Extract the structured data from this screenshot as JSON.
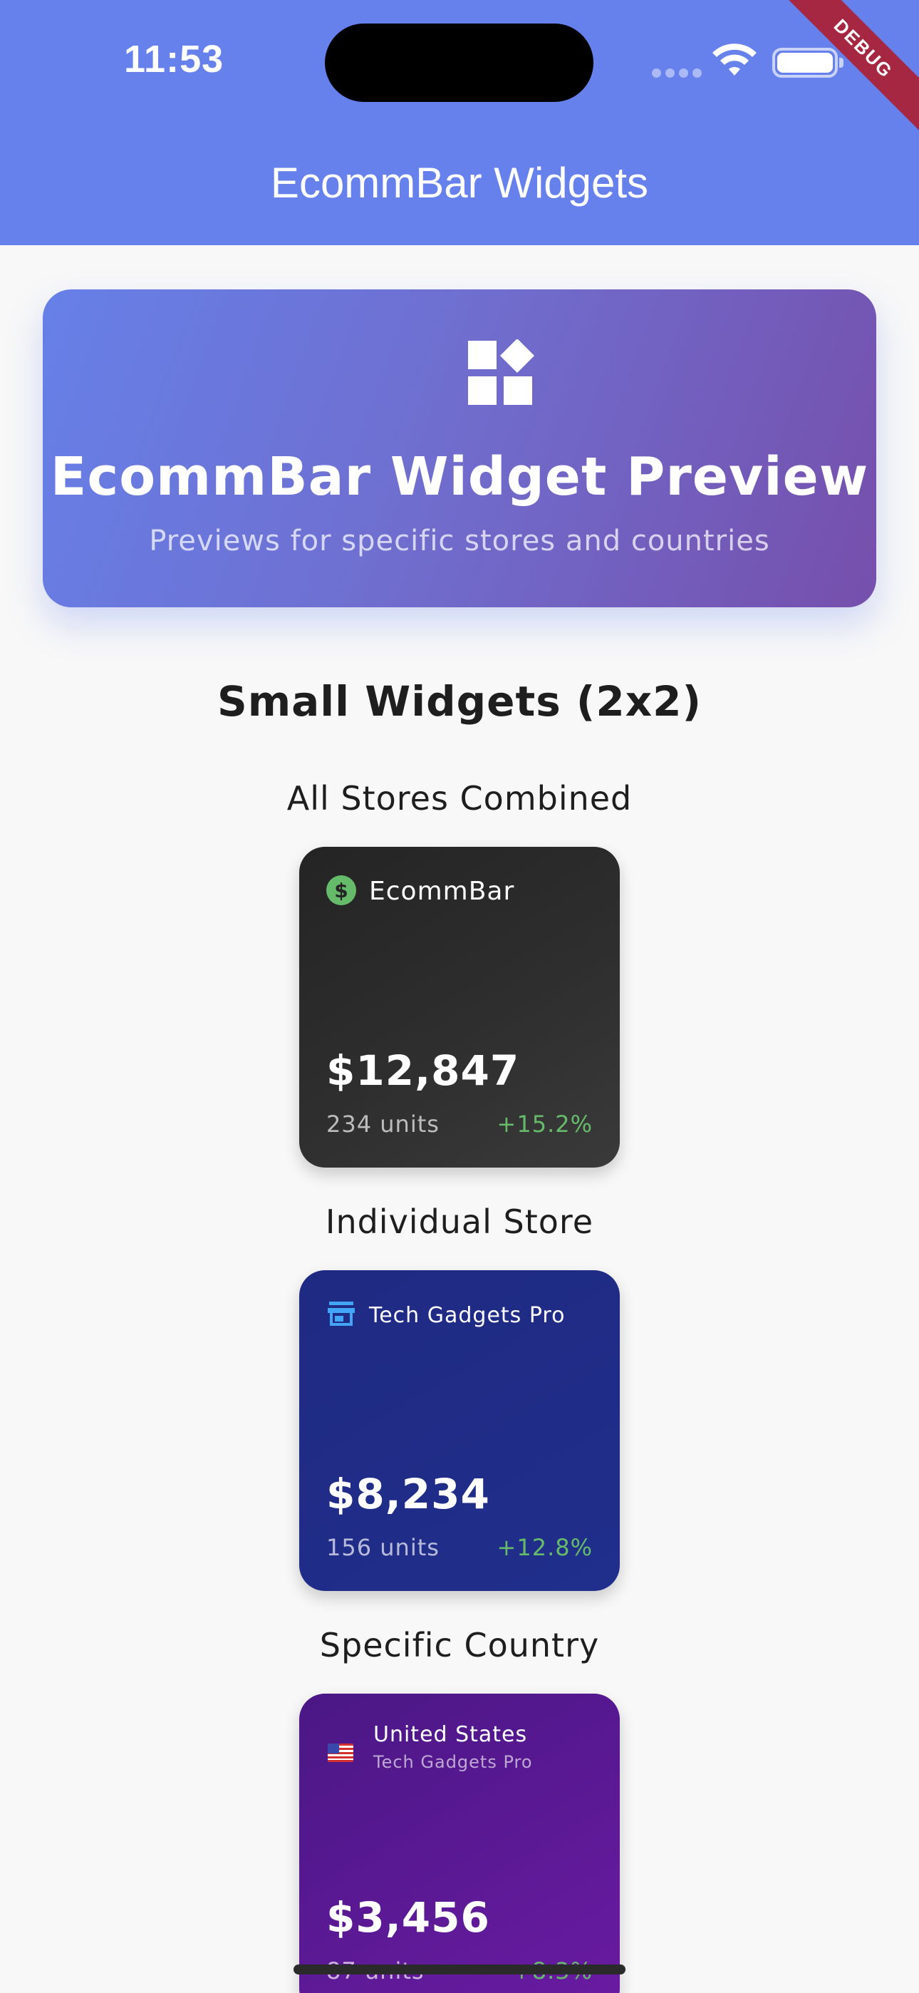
{
  "status_bar": {
    "time": "11:53",
    "debug_label": "DEBUG"
  },
  "app_bar": {
    "title": "EcommBar Widgets"
  },
  "hero": {
    "icon": "widgets-icon",
    "title": "EcommBar Widget Preview",
    "subtitle": "Previews for specific stores and countries"
  },
  "section": {
    "title": "Small Widgets (2x2)"
  },
  "widgets": [
    {
      "label": "All Stores Combined",
      "icon": "dollar-icon",
      "title": "EcommBar",
      "amount": "$12,847",
      "units": "234 units",
      "change": "+15.2%"
    },
    {
      "label": "Individual Store",
      "icon": "store-icon",
      "title": "Tech Gadgets Pro",
      "amount": "$8,234",
      "units": "156 units",
      "change": "+12.8%"
    },
    {
      "label": "Specific Country",
      "icon": "us-flag-icon",
      "title": "United States",
      "subtitle": "Tech Gadgets Pro",
      "amount": "$3,456",
      "units": "87 units",
      "change": "+8.3%"
    }
  ],
  "colors": {
    "app_bar": "#6680ec",
    "hero_start": "#6680e8",
    "hero_end": "#764fac",
    "positive_change": "#66bb6a",
    "widget_dark": "#2e2e2e",
    "widget_blue": "#202f8c",
    "widget_purple": "#5a1994",
    "debug_banner": "#a52741"
  }
}
